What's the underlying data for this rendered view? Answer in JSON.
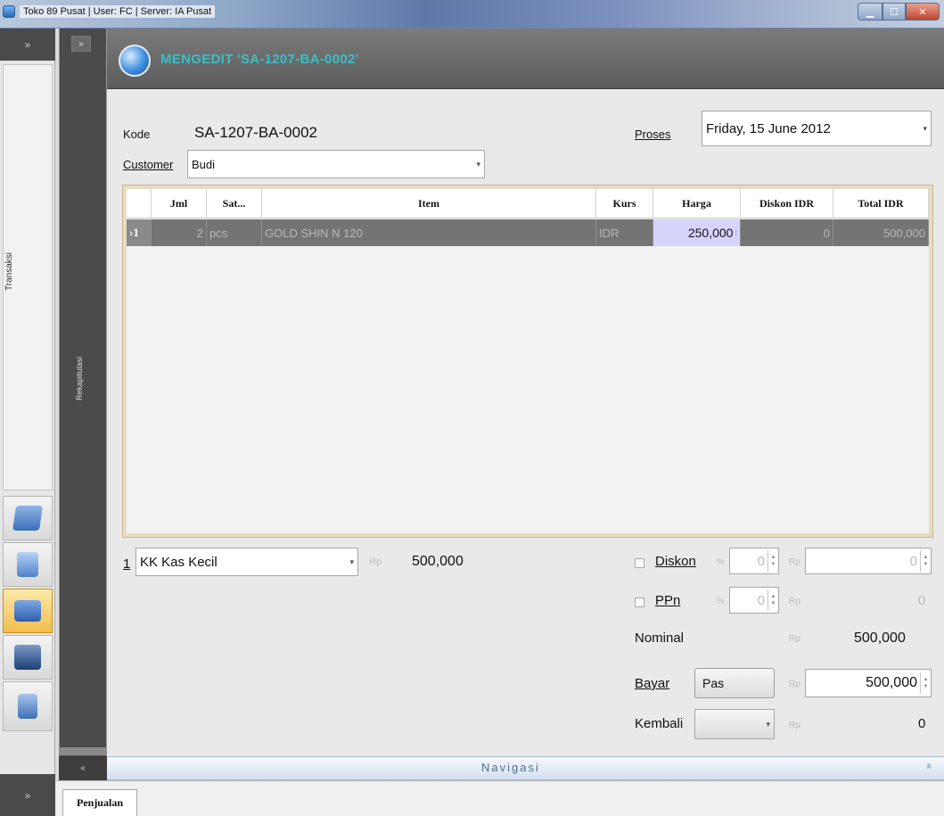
{
  "window": {
    "title": "Toko 89 Pusat  |  User: FC  |  Server: IA Pusat"
  },
  "sidebar": {
    "section_label": "Transaksi",
    "panel2_label": "Rekapitulasi",
    "toggle_top": "»",
    "toggle_bottom": "»",
    "collapse2": "«"
  },
  "header": {
    "title": "MENGEDIT 'SA-1207-BA-0002'"
  },
  "form": {
    "kode_label": "Kode",
    "kode_value": "SA-1207-BA-0002",
    "proses_label": "Proses",
    "proses_value": "Friday,  15 June 2012",
    "customer_label": "Customer",
    "customer_value": "Budi"
  },
  "grid": {
    "columns": [
      "",
      "Jml",
      "Sat...",
      "Item",
      "Kurs",
      "Harga",
      "Diskon IDR",
      "Total IDR"
    ],
    "rows": [
      {
        "no": "1",
        "jml": "2",
        "sat": "pcs",
        "item": "GOLD SHIN N 120",
        "kurs": "IDR",
        "harga": "250,000",
        "diskon": "0",
        "total": "500,000"
      }
    ]
  },
  "payment": {
    "index": "1",
    "account": "KK Kas Kecil",
    "currency_symbol": "Rp",
    "amount": "500,000",
    "diskon_label": "Diskon",
    "diskon_pct": "0",
    "diskon_amt": "0",
    "ppn_label": "PPn",
    "ppn_pct": "0",
    "ppn_amt": "0",
    "percent_symbol": "%",
    "nominal_label": "Nominal",
    "nominal_value": "500,000",
    "bayar_label": "Bayar",
    "pas_button": "Pas",
    "bayar_value": "500,000",
    "kembali_label": "Kembali",
    "kembali_value": "0"
  },
  "navigation": {
    "label": "Navigasi",
    "chevron": "»"
  },
  "tabs": [
    {
      "label": "Penjualan"
    }
  ]
}
